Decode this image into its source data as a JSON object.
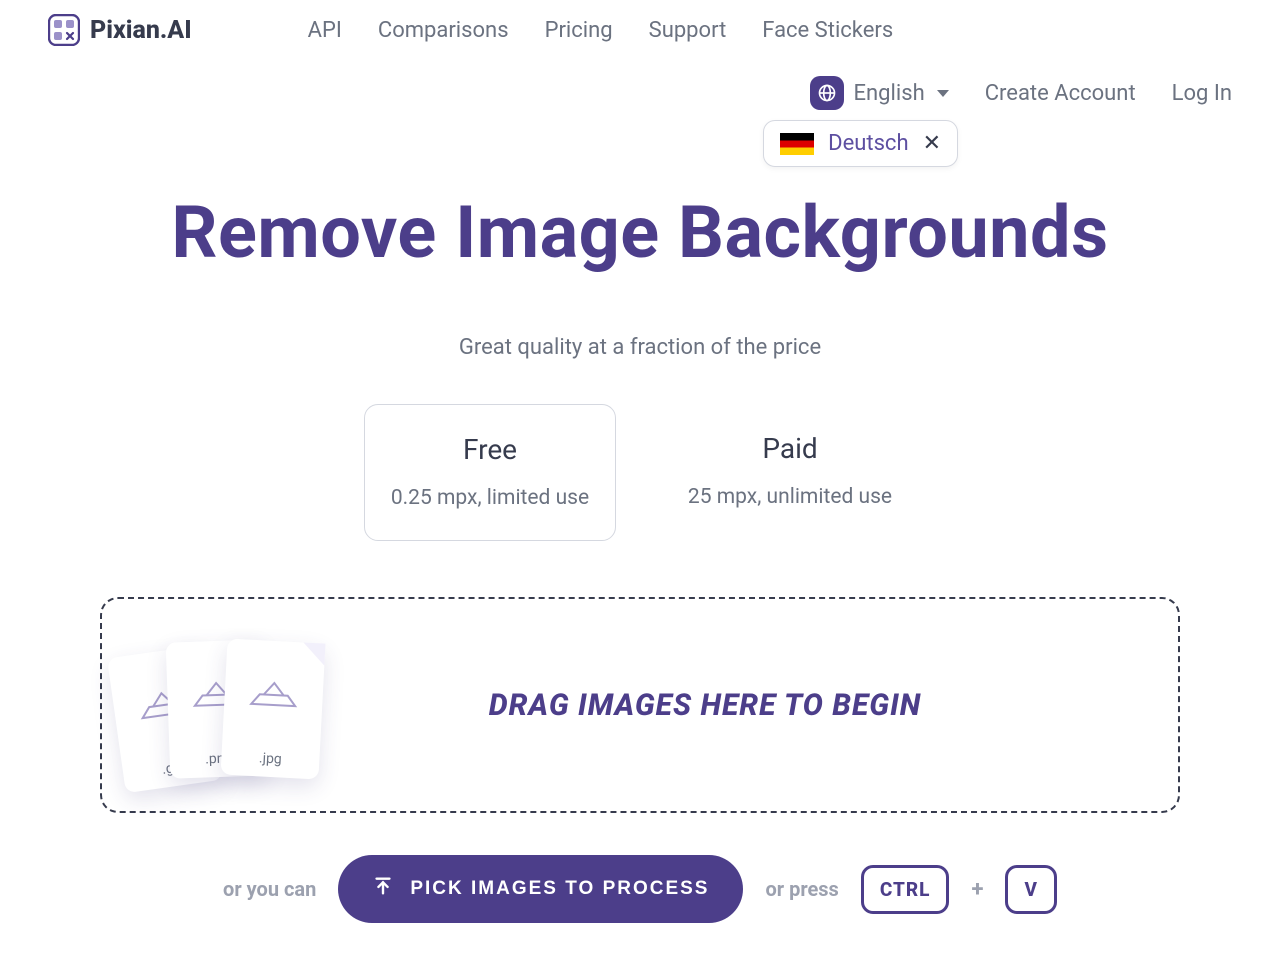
{
  "brand": {
    "name": "Pixian.AI"
  },
  "nav": {
    "items": [
      "API",
      "Comparisons",
      "Pricing",
      "Support",
      "Face Stickers"
    ]
  },
  "account": {
    "language_current": "English",
    "language_suggestion": "Deutsch",
    "create": "Create Account",
    "login": "Log In"
  },
  "hero": {
    "title": "Remove Image Backgrounds",
    "subtitle": "Great quality at a fraction of the price"
  },
  "plans": {
    "free": {
      "title": "Free",
      "desc": "0.25 mpx, limited use"
    },
    "paid": {
      "title": "Paid",
      "desc": "25 mpx, unlimited use"
    }
  },
  "dropzone": {
    "text": "DRAG IMAGES HERE TO BEGIN",
    "ext1": ".gif",
    "ext2": ".png",
    "ext3": ".jpg"
  },
  "actions": {
    "or_you_can": "or you can",
    "pick_button": "PICK IMAGES TO PROCESS",
    "or_press": "or press",
    "key_ctrl": "CTRL",
    "plus": "+",
    "key_v": "V"
  }
}
